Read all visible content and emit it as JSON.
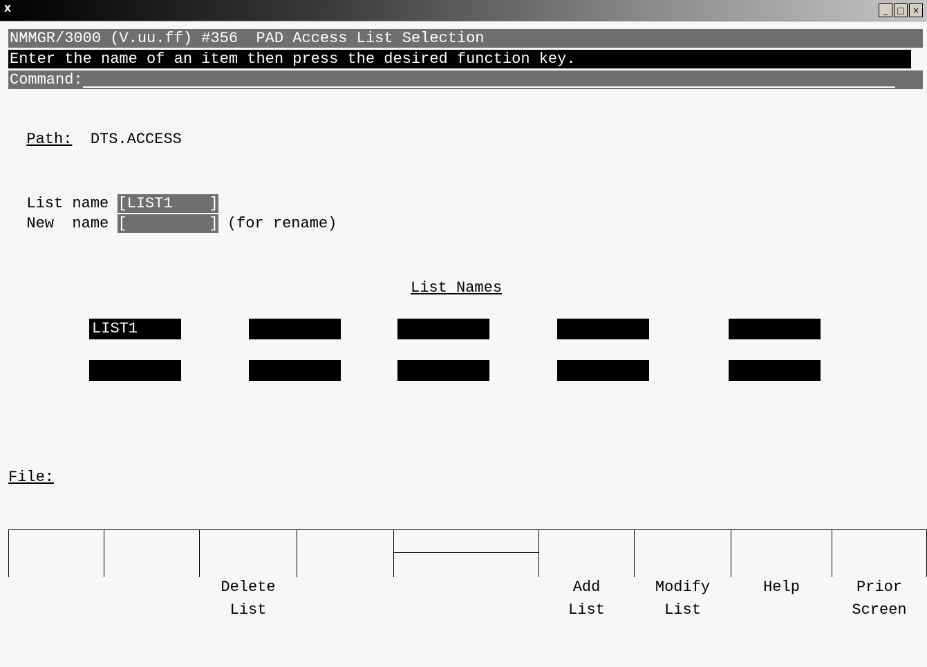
{
  "window": {
    "icon_label": "X",
    "buttons": [
      "_",
      "□",
      "×"
    ]
  },
  "screen": {
    "title_line": "NMMGR/3000 (V.uu.ff) #356  PAD Access List Selection",
    "instruction_line": "Enter the name of an item then press the desired function key.",
    "command_label": "Command:",
    "path_label": "Path:",
    "path_value": "DTS.ACCESS",
    "list_name_label": "List name ",
    "list_name_value": "[LIST1    ]",
    "new_name_label": "New  name ",
    "new_name_value": "[         ]",
    "rename_hint": " (for rename)",
    "list_names_heading": "List Names",
    "list_names": [
      "LIST1",
      "",
      "",
      "",
      "",
      "",
      "",
      "",
      "",
      ""
    ],
    "file_label": "File:"
  },
  "function_keys": [
    {
      "line1": "",
      "line2": ""
    },
    {
      "line1": "",
      "line2": ""
    },
    {
      "line1": "Delete",
      "line2": "List"
    },
    {
      "line1": "",
      "line2": ""
    },
    {
      "line1": "",
      "line2": ""
    },
    {
      "line1": "Add",
      "line2": "List"
    },
    {
      "line1": "Modify",
      "line2": "List"
    },
    {
      "line1": "Help",
      "line2": ""
    },
    {
      "line1": "Prior",
      "line2": "Screen"
    }
  ]
}
